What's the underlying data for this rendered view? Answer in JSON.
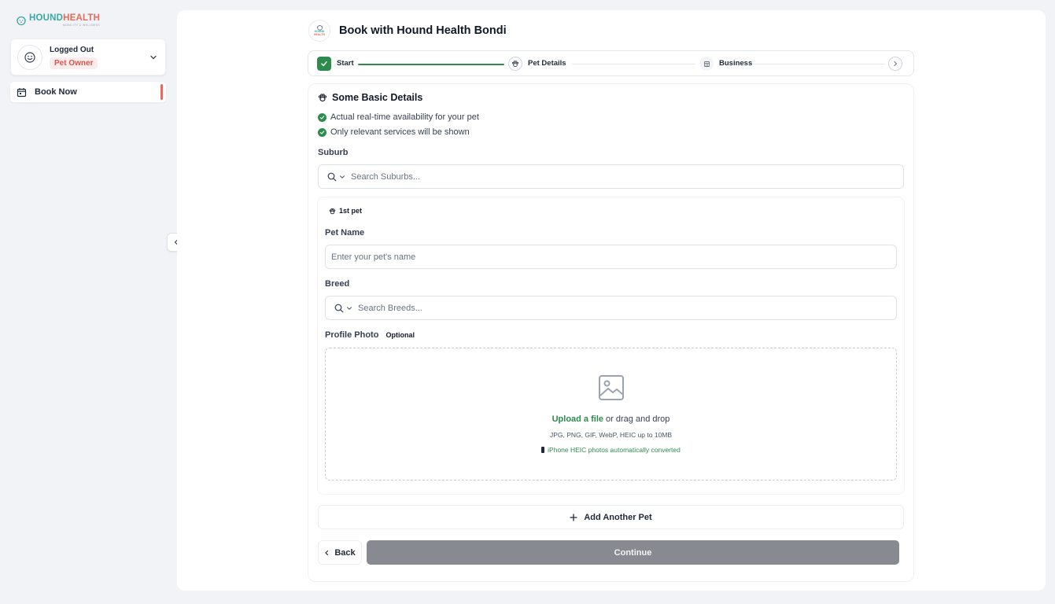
{
  "sidebar": {
    "logo": {
      "part1": "HOUND",
      "part2": "HEALTH",
      "tagline": "MOBILITY & WELLNESS"
    },
    "user": {
      "status": "Logged Out",
      "role": "Pet Owner"
    },
    "nav": [
      {
        "label": "Book Now",
        "icon": "calendar-icon",
        "active": true
      }
    ]
  },
  "header": {
    "business_logo_text": [
      "HOUND",
      "HEALTH"
    ],
    "title": "Book with Hound Health Bondi"
  },
  "stepper": {
    "steps": [
      {
        "label": "Start",
        "state": "complete"
      },
      {
        "label": "Pet Details",
        "state": "current"
      },
      {
        "label": "Business",
        "state": "upcoming"
      }
    ]
  },
  "form": {
    "section_title": "Some Basic Details",
    "benefits": [
      "Actual real-time availability for your pet",
      "Only relevant services will be shown"
    ],
    "suburb": {
      "label": "Suburb",
      "placeholder": "Search Suburbs..."
    },
    "pet": {
      "tag": "1st pet",
      "name_label": "Pet Name",
      "name_placeholder": "Enter your pet's name",
      "breed_label": "Breed",
      "breed_placeholder": "Search Breeds...",
      "photo_label": "Profile Photo",
      "photo_optional": "Optional",
      "upload_link": "Upload a file",
      "upload_text": " or drag and drop",
      "upload_formats": "JPG, PNG, GIF, WebP, HEIC up to 10MB",
      "upload_note": "iPhone HEIC photos automatically converted"
    },
    "add_pet_label": "Add Another Pet",
    "back_label": "Back",
    "continue_label": "Continue"
  },
  "colors": {
    "accent_green": "#2e8b4e",
    "brand_teal": "#3aa7a8",
    "brand_coral": "#e76a5b",
    "continue_disabled": "#878a90"
  }
}
